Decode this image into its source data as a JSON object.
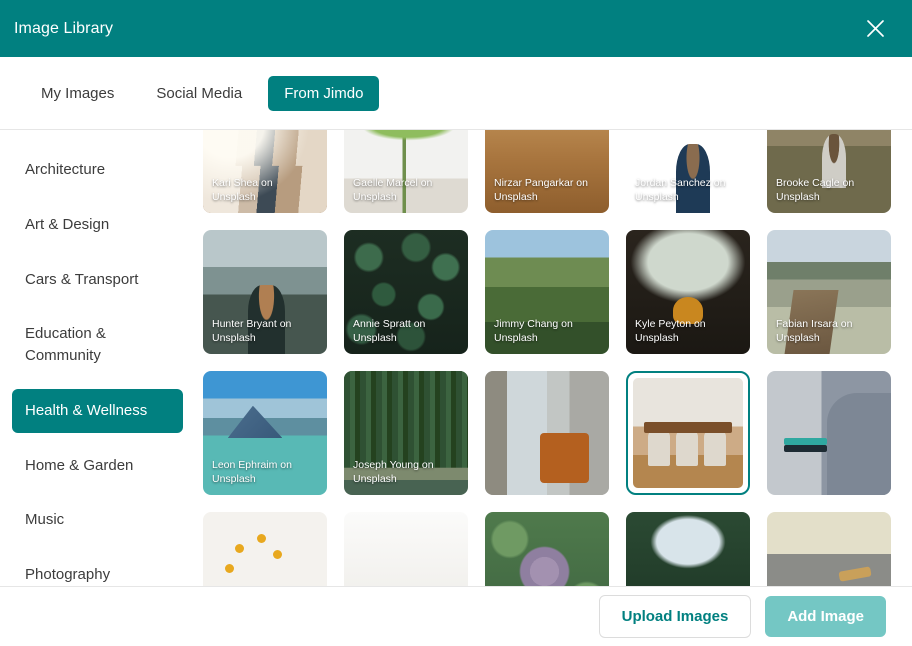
{
  "window": {
    "title": "Image Library",
    "close_icon": "close-icon"
  },
  "tabs": [
    {
      "label": "My Images",
      "active": false
    },
    {
      "label": "Social Media",
      "active": false
    },
    {
      "label": "From Jimdo",
      "active": true
    }
  ],
  "sidebar": {
    "items": [
      {
        "label": "Architecture",
        "active": false
      },
      {
        "label": "Art & Design",
        "active": false
      },
      {
        "label": "Cars & Transport",
        "active": false
      },
      {
        "label": "Education & Community",
        "active": false
      },
      {
        "label": "Health & Wellness",
        "active": true
      },
      {
        "label": "Home & Garden",
        "active": false
      },
      {
        "label": "Music",
        "active": false
      },
      {
        "label": "Photography",
        "active": false
      }
    ]
  },
  "grid": {
    "tiles": [
      {
        "caption": "Kari Shea on Unsplash",
        "pic": "p-interior1",
        "selected": false
      },
      {
        "caption": "Gaelle Marcel on Unsplash",
        "pic": "p-plant",
        "selected": false
      },
      {
        "caption": "Nirzar Pangarkar on Unsplash",
        "pic": "p-chairs",
        "selected": false
      },
      {
        "caption": "Jordan Sanchez on Unsplash",
        "pic": "p-forest-girl",
        "selected": false
      },
      {
        "caption": "Brooke Cagle on Unsplash",
        "pic": "p-field-girl",
        "selected": false
      },
      {
        "caption": "Hunter Bryant on Unsplash",
        "pic": "p-mountain-man",
        "selected": false
      },
      {
        "caption": "Annie Spratt on Unsplash",
        "pic": "p-leaves",
        "selected": false
      },
      {
        "caption": "Jimmy Chang on Unsplash",
        "pic": "p-greenmtn",
        "selected": false
      },
      {
        "caption": "Kyle Peyton on Unsplash",
        "pic": "p-snowtree",
        "selected": false
      },
      {
        "caption": "Fabian Irsara on Unsplash",
        "pic": "p-lakepath",
        "selected": false
      },
      {
        "caption": "Leon Ephraim on Unsplash",
        "pic": "p-bluelake",
        "selected": false
      },
      {
        "caption": "Joseph Young on Unsplash",
        "pic": "p-pines",
        "selected": false
      },
      {
        "caption": "",
        "pic": "p-lounge",
        "selected": false
      },
      {
        "caption": "",
        "pic": "p-dining",
        "selected": true
      },
      {
        "caption": "",
        "pic": "p-sofa",
        "selected": false
      },
      {
        "caption": "",
        "pic": "p-flowers",
        "selected": false
      },
      {
        "caption": "",
        "pic": "p-white",
        "selected": false
      },
      {
        "caption": "",
        "pic": "p-succulent",
        "selected": false
      },
      {
        "caption": "",
        "pic": "p-canopy",
        "selected": false
      },
      {
        "caption": "",
        "pic": "p-desk",
        "selected": false
      }
    ]
  },
  "footer": {
    "upload_label": "Upload Images",
    "add_label": "Add Image"
  },
  "colors": {
    "accent": "#018080",
    "accent_disabled": "#74c7c4",
    "text": "#3c3c3c"
  }
}
